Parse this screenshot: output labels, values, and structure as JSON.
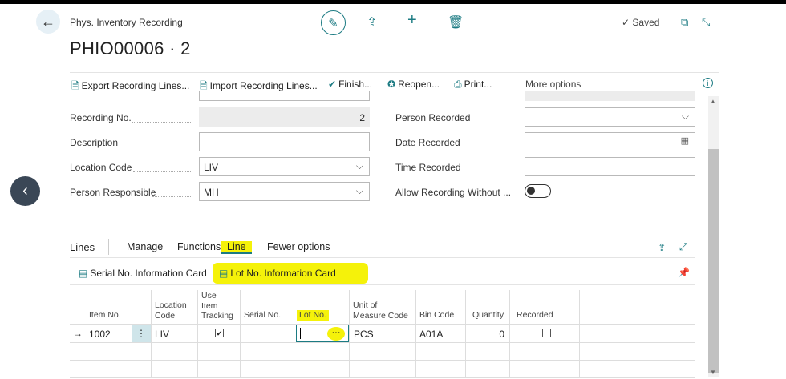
{
  "header": {
    "breadcrumb": "Phys. Inventory Recording",
    "title": "PHIO00006 · 2",
    "status": "Saved"
  },
  "actions": {
    "export": "Export Recording Lines...",
    "import": "Import Recording Lines...",
    "finish": "Finish...",
    "reopen": "Reopen...",
    "print": "Print...",
    "more": "More options"
  },
  "form": {
    "recording_no_label": "Recording No.",
    "recording_no_value": "2",
    "description_label": "Description",
    "description_value": "",
    "location_code_label": "Location Code",
    "location_code_value": "LIV",
    "person_responsible_label": "Person Responsible",
    "person_responsible_value": "MH",
    "person_recorded_label": "Person Recorded",
    "person_recorded_value": "",
    "date_recorded_label": "Date Recorded",
    "date_recorded_value": "",
    "time_recorded_label": "Time Recorded",
    "time_recorded_value": "",
    "allow_recording_label": "Allow Recording Without ...",
    "allow_recording_value": "off"
  },
  "lines": {
    "title": "Lines",
    "tabs": [
      "Manage",
      "Functions",
      "Line",
      "Fewer options"
    ],
    "sub_actions": {
      "serial": "Serial No. Information Card",
      "lot": "Lot No. Information Card"
    },
    "columns": {
      "item_no": "Item No.",
      "location_code": [
        "Location",
        "Code"
      ],
      "use_item_tracking": [
        "Use",
        "Item",
        "Tracking"
      ],
      "serial_no": "Serial No.",
      "lot_no": "Lot No.",
      "unit_of_measure": [
        "Unit of",
        "Measure Code"
      ],
      "bin_code": "Bin Code",
      "quantity": "Quantity",
      "recorded": "Recorded"
    },
    "rows": [
      {
        "item_no": "1002",
        "location_code": "LIV",
        "use_item_tracking": true,
        "serial_no": "",
        "lot_no": "",
        "unit_of_measure": "PCS",
        "bin_code": "A01A",
        "quantity": "0",
        "recorded": false
      }
    ]
  },
  "colors": {
    "accent": "#1c7b83",
    "highlight": "#f5f20a"
  }
}
